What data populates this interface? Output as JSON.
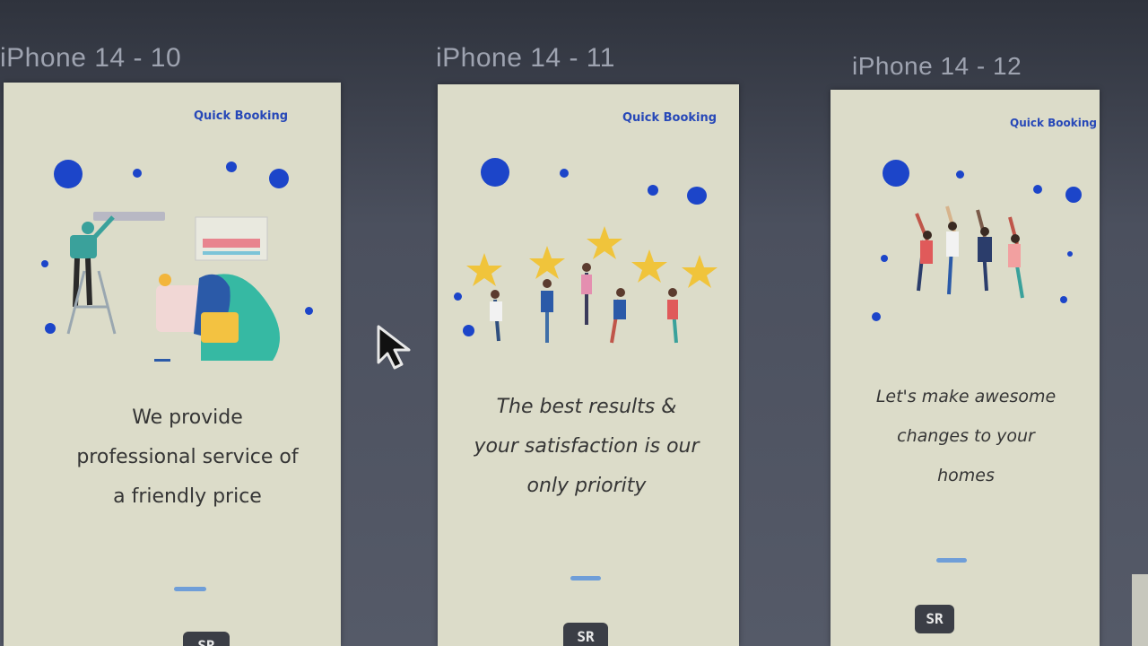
{
  "frames": [
    {
      "label": "iPhone 14 - 10",
      "brand": "Quick Booking",
      "tagline_lines": [
        "We provide",
        "professional service of",
        "a friendly price"
      ],
      "illustration": "technician-and-woman-illustration",
      "logo": "SR"
    },
    {
      "label": "iPhone 14 - 11",
      "brand": "Quick Booking",
      "tagline_lines": [
        "The best results &",
        "your satisfaction is our",
        "only priority"
      ],
      "illustration": "people-holding-stars-illustration",
      "logo": "SR"
    },
    {
      "label": "iPhone 14 - 12",
      "brand": "Quick Booking",
      "tagline_lines": [
        "Let's make awesome",
        "changes to your",
        "homes"
      ],
      "illustration": "people-jumping-illustration",
      "logo": "SR"
    }
  ],
  "colors": {
    "accent": "#1c45c9",
    "screen_bg": "#dcdcc9",
    "canvas_bg": "#4a4f5c",
    "indicator": "#6f9ed8"
  },
  "icons": {
    "cursor": "mouse-pointer-icon"
  }
}
